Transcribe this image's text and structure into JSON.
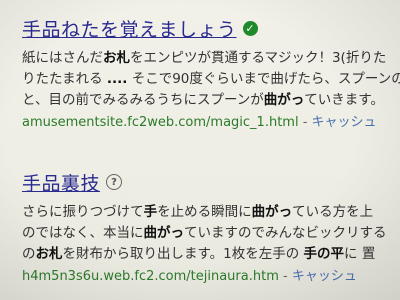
{
  "results": [
    {
      "title": "手品ねたを覚えましょう",
      "snippet_lines": [
        [
          "紙にはさんだ",
          "<b>お札</b>",
          "をエンピツが貫通するマジック！3(折りた"
        ],
        [
          "りたたまれる ",
          "<b>....</b>",
          " そこで90度ぐらいまで曲げたら、スプーンの"
        ],
        [
          "と、目の前でみるみるうちにスプーンが",
          "<b>曲がっ</b>",
          "ていきます。"
        ]
      ],
      "url": "amusementsite.fc2web.com/magic_1.html",
      "separator": " - ",
      "cache": "キャッシュ"
    },
    {
      "title": "手品裏技",
      "snippet_lines": [
        [
          "さらに振りつづけて",
          "<b>手</b>",
          "を止める瞬間に",
          "<b>曲がっ</b>",
          "ている方を上"
        ],
        [
          "のではなく、本当に",
          "<b>曲がっ</b>",
          "ていますのでみんなビックリする"
        ],
        [
          "の",
          "<b>お札</b>",
          "を財布から取り出します。1枚を左手の ",
          "<b>手の平</b>",
          "に 置"
        ]
      ],
      "url": "h4m5n3s6u.web.fc2.com/tejinaura.htm",
      "separator": " - ",
      "cache": "キャッシュ"
    }
  ]
}
